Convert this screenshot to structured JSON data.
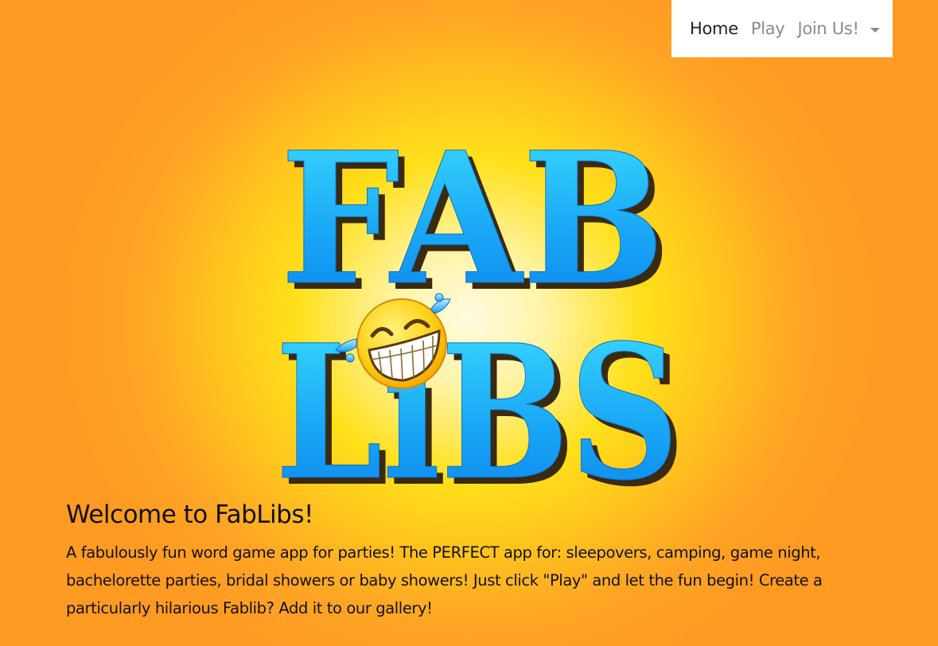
{
  "nav": {
    "home_label": "Home",
    "play_label": "Play",
    "join_label": "Join Us!"
  },
  "logo": {
    "line1": "FAB",
    "line2": "LiBS",
    "icon": "laughing-emoji-icon"
  },
  "welcome": {
    "title": "Welcome to FabLibs!",
    "body": "A fabulously fun word game app for parties! The PERFECT app for: sleepovers, camping, game night, bachelorette parties, bridal showers or baby showers! Just click \"Play\" and let the fun begin! Create a particularly hilarious Fablib? Add it to our gallery!"
  },
  "colors": {
    "background_outer": "#ff9a22",
    "background_center": "#fff4a8",
    "logo_blue_top": "#38d8ff",
    "logo_blue_bottom": "#0a84ef",
    "logo_shadow": "#3a2a10",
    "emoji_yellow": "#ffd21a"
  }
}
